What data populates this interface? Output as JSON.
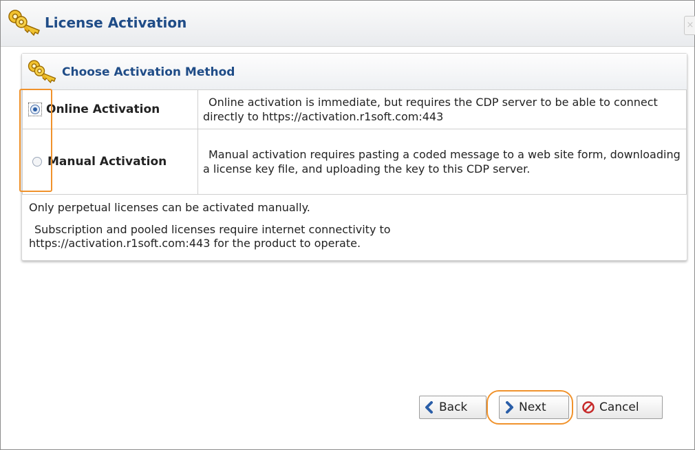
{
  "dialog": {
    "title": "License Activation",
    "title_icon": "keys-icon",
    "close_label": "×"
  },
  "panel": {
    "title": "Choose Activation Method",
    "title_icon": "keys-icon",
    "options": [
      {
        "label": "Online Activation",
        "selected": true,
        "description": "Online activation is immediate, but requires the CDP server to be able to connect directly to https://activation.r1soft.com:443"
      },
      {
        "label": "Manual Activation",
        "selected": false,
        "description": "Manual activation requires pasting a coded message to a web site form, downloading a license key file, and uploading the key to this CDP server."
      }
    ],
    "note_manual": "Only perpetual licenses can be activated manually.",
    "note_subscription_line1": "Subscription and pooled licenses require internet connectivity to",
    "note_subscription_line2": "https://activation.r1soft.com:443 for the product to operate."
  },
  "buttons": {
    "back": "Back",
    "next": "Next",
    "cancel": "Cancel"
  },
  "colors": {
    "title_text": "#1f4c87",
    "highlight": "#f0922b",
    "arrow": "#2a5ea8",
    "cancel_icon": "#c62828"
  }
}
